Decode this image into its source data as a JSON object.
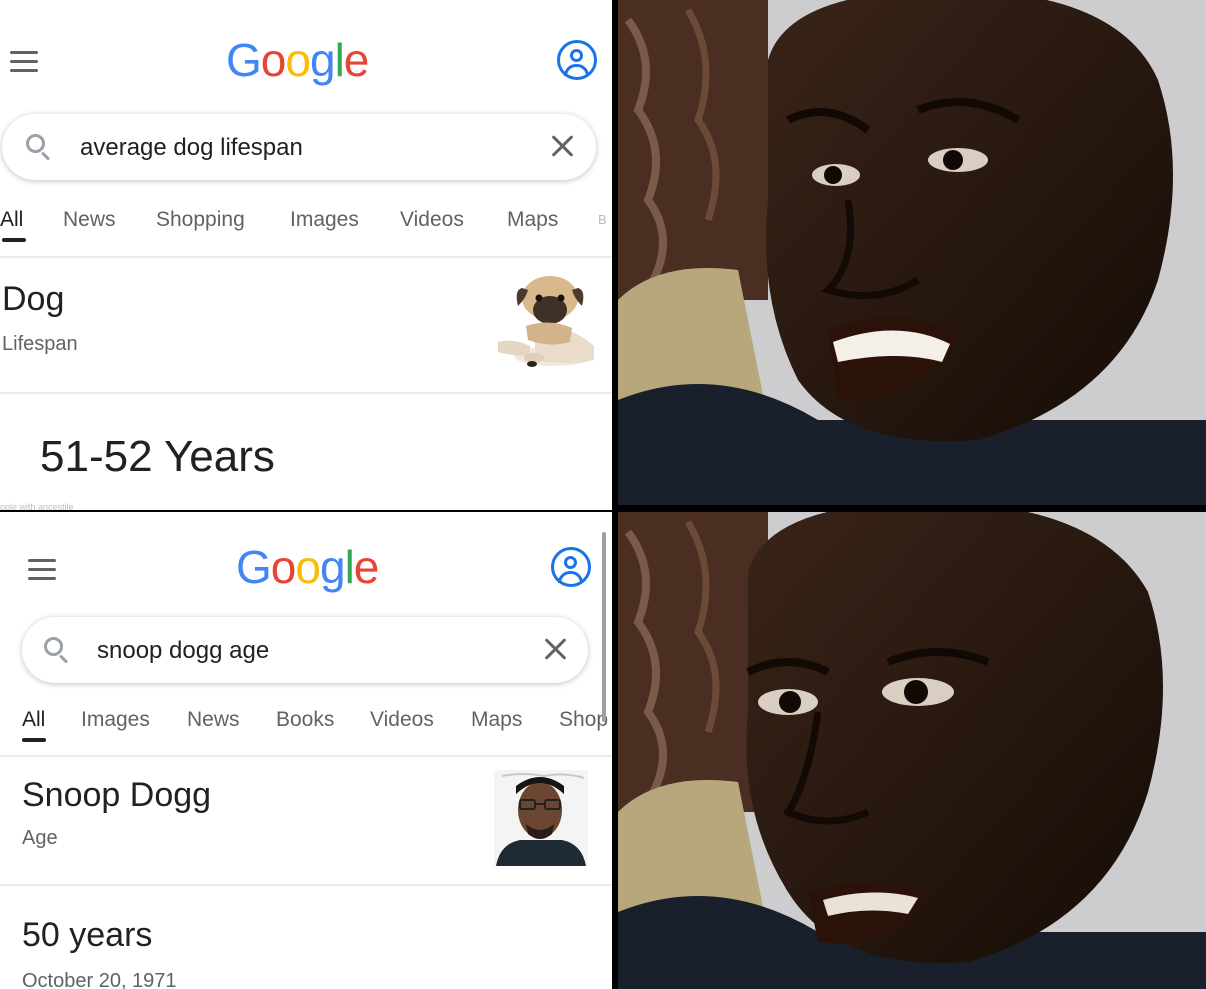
{
  "colors": {
    "google_blue": "#4285F4",
    "google_red": "#EA4335",
    "google_yellow": "#FBBC05",
    "google_green": "#34A853",
    "account_blue": "#1a73e8"
  },
  "top": {
    "logo_letters": [
      "G",
      "o",
      "o",
      "g",
      "l",
      "e"
    ],
    "query": "average dog lifespan",
    "tabs": [
      "All",
      "News",
      "Shopping",
      "Images",
      "Videos",
      "Maps",
      "B"
    ],
    "entity_title": "Dog",
    "entity_subtitle": "Lifespan",
    "answer": "51-52 Years",
    "faint_caption": "ople with ancestile",
    "thumbnail_icon": "pug-dog-photo"
  },
  "bottom": {
    "logo_letters": [
      "G",
      "o",
      "o",
      "g",
      "l",
      "e"
    ],
    "query": "snoop dogg age",
    "tabs": [
      "All",
      "Images",
      "News",
      "Books",
      "Videos",
      "Maps",
      "Shop"
    ],
    "entity_title": "Snoop Dogg",
    "entity_subtitle": "Age",
    "answer": "50 years",
    "date": "October 20, 1971",
    "thumbnail_icon": "snoop-dogg-portrait"
  },
  "reaction_images": [
    "smiling-man-photo",
    "disappointed-man-photo"
  ]
}
